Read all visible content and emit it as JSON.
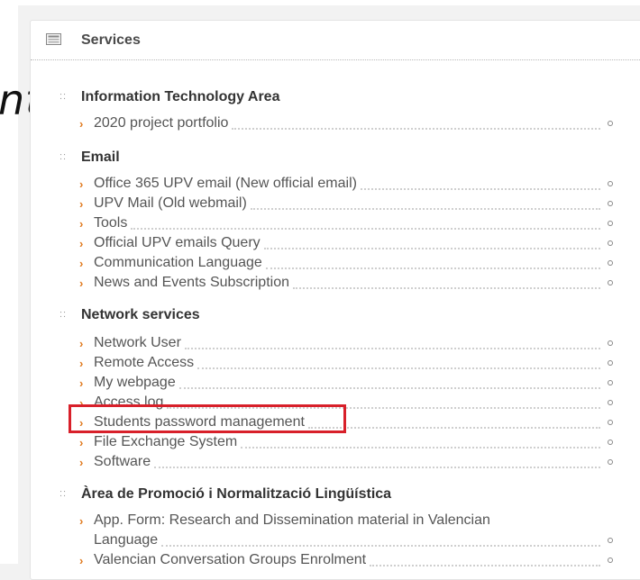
{
  "background_text": "nt",
  "panel": {
    "title": "Services",
    "icon": "list-icon"
  },
  "sections": [
    {
      "title": "Information Technology Area",
      "items": [
        "2020 project portfolio"
      ]
    },
    {
      "title": "Email",
      "items": [
        "Office 365 UPV email (New official email)",
        "UPV Mail (Old webmail)",
        "Tools",
        "Official UPV emails Query",
        "Communication Language",
        "News and Events Subscription"
      ]
    },
    {
      "title": "Network services",
      "items": [
        "Network User",
        "Remote Access",
        "My webpage",
        "Access log",
        "Students password management",
        "File Exchange System",
        "Software"
      ]
    },
    {
      "title": "Àrea de Promoció i Normalització Lingüística",
      "items_multi": {
        "line1": "App. Form: Research and Dissemination material in Valencian",
        "line2": "Language"
      },
      "items": [
        "Valencian Conversation Groups Enrolment"
      ]
    }
  ],
  "colors": {
    "highlight": "#d8202a",
    "chevron": "#e07a1f"
  }
}
